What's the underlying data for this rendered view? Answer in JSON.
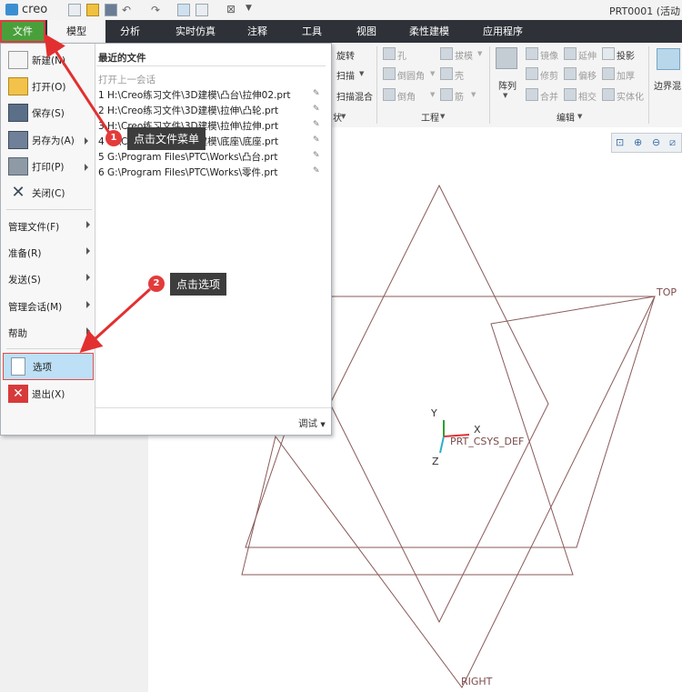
{
  "app": {
    "logo": "creo",
    "window_title": "PRT0001 (活动",
    "quick_access_icons": [
      "new-file-icon",
      "open-folder-icon",
      "save-icon",
      "undo-icon",
      "redo-icon",
      "regenerate-icon",
      "window-icon",
      "close-window-icon",
      "customize-icon"
    ]
  },
  "tabs": [
    "文件",
    "模型",
    "分析",
    "实时仿真",
    "注释",
    "工具",
    "视图",
    "柔性建模",
    "应用程序"
  ],
  "ribbon": {
    "shape_group": [
      "旋转",
      "扫描",
      "扫描混合"
    ],
    "shape_group_label_tail": "状",
    "engineering": {
      "items": [
        "孔",
        "倒圆角",
        "倒角",
        "拔模",
        "壳",
        "筋"
      ],
      "label": "工程"
    },
    "pattern": {
      "label": "阵列"
    },
    "editing": {
      "items": [
        "镜像",
        "修剪",
        "合并",
        "延伸",
        "偏移",
        "相交",
        "投影",
        "加厚",
        "实体化"
      ],
      "label": "编辑"
    },
    "surfaces": {
      "item": "边界混"
    }
  },
  "file_menu": {
    "primary": [
      {
        "label": "新建(N)",
        "icon": "new-file-icon"
      },
      {
        "label": "打开(O)",
        "icon": "open-folder-icon"
      },
      {
        "label": "保存(S)",
        "icon": "save-icon"
      },
      {
        "label": "另存为(A)",
        "icon": "save-as-icon"
      },
      {
        "label": "打印(P)",
        "icon": "print-icon"
      },
      {
        "label": "关闭(C)",
        "icon": "close-icon"
      }
    ],
    "submenus": [
      "管理文件(F)",
      "准备(R)",
      "发送(S)",
      "管理会话(M)",
      "帮助"
    ],
    "options": "选项",
    "exit": "退出(X)",
    "recent_title": "最近的文件",
    "open_last_session": "打开上一会话",
    "recent_files": [
      "1 H:\\Creo练习文件\\3D建模\\凸台\\拉伸02.prt",
      "2 H:\\Creo练习文件\\3D建模\\拉伸\\凸轮.prt",
      "3 H:\\Creo练习文件\\3D建模\\拉伸\\拉伸.prt",
      "4 H:\\Creo练习文件\\3D建模\\底座\\底座.prt",
      "5 G:\\Program Files\\PTC\\Works\\凸台.prt",
      "6 G:\\Program Files\\PTC\\Works\\零件.prt"
    ],
    "debug": "调试"
  },
  "annotations": [
    {
      "number": "1",
      "text": "点击文件菜单"
    },
    {
      "number": "2",
      "text": "点击选项"
    }
  ],
  "viewport": {
    "planes": [
      "TOP",
      "RIGHT"
    ],
    "csys_label": "PRT_CSYS_DEF",
    "axes": [
      "X",
      "Y",
      "Z"
    ],
    "line_color": "#8a5a5a",
    "arrow_color": "#e23030"
  }
}
